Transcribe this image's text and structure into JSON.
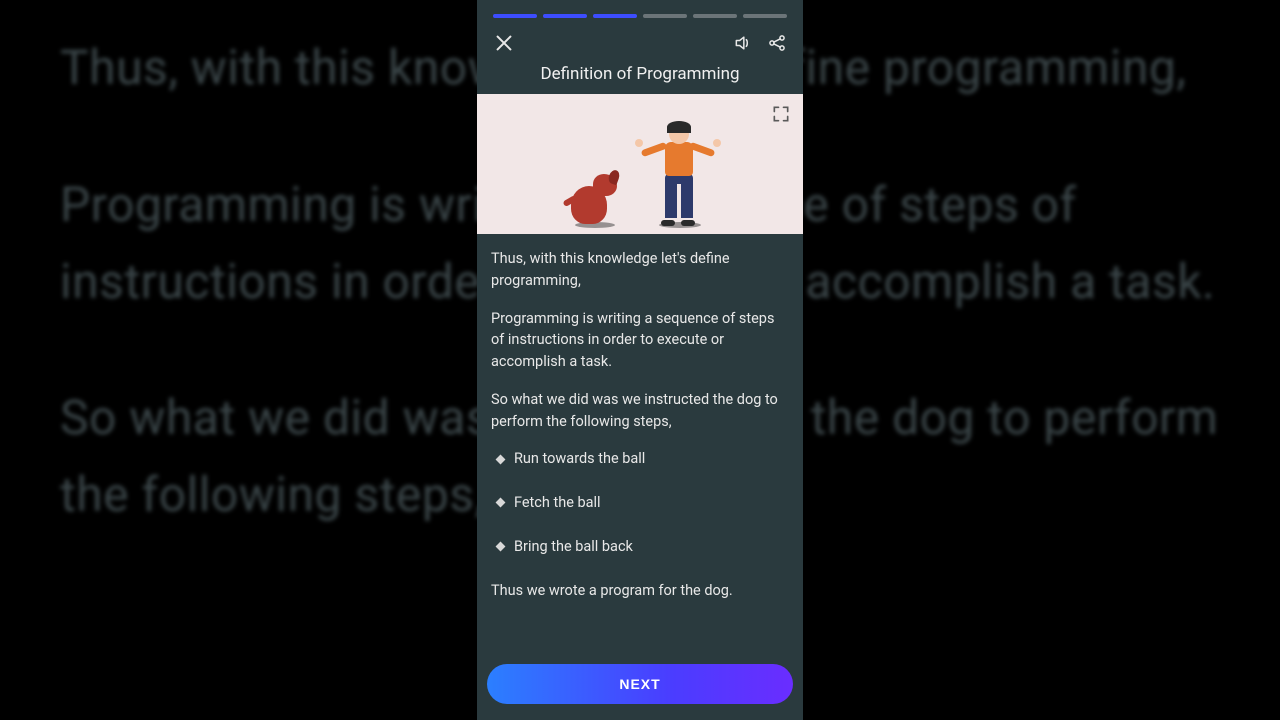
{
  "bg": {
    "p1": "Thus, with this knowledge let's define programming,",
    "p2": "Programming is writing a sequence of steps of instructions in order to execute or accomplish a task.",
    "p3": "So what we did was we instructed the dog to perform the following steps,"
  },
  "progress": {
    "total": 6,
    "completed": 3
  },
  "title": "Definition of Programming",
  "content": {
    "p1": "Thus, with this knowledge let's define programming,",
    "p2": "Programming is writing a sequence of steps of instructions in order to execute or accomplish a task.",
    "p3": "So what we did was we instructed the dog to perform the following steps,",
    "bullets": [
      "Run towards the ball",
      "Fetch the ball",
      "Bring the ball back"
    ],
    "p4": "Thus we wrote a program for the dog."
  },
  "next_label": "NEXT"
}
